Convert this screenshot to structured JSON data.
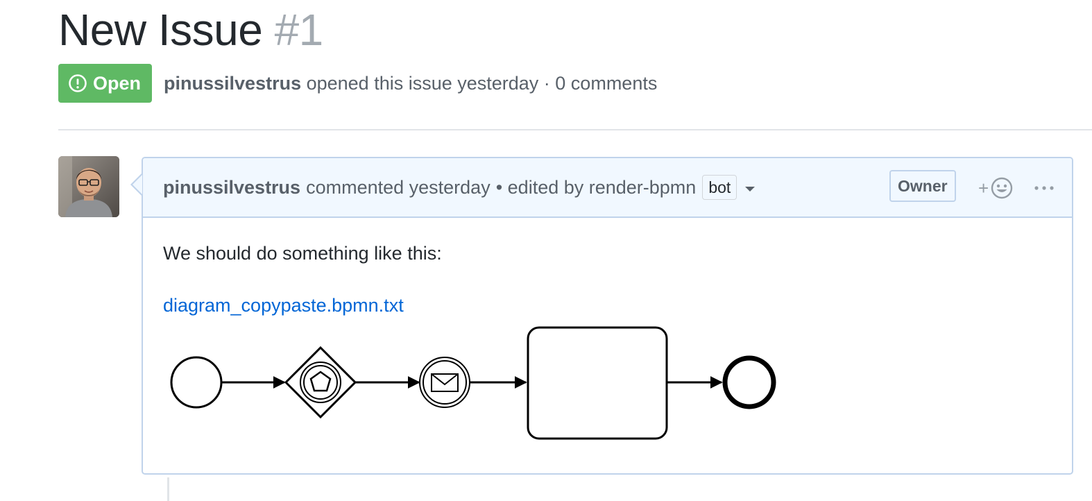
{
  "issue": {
    "title": "New Issue",
    "number": "#1",
    "state": "Open",
    "state_icon": "issue-opened-icon",
    "author": "pinussilvestrus",
    "meta_text": " opened this issue yesterday · 0 comments"
  },
  "comment": {
    "author": "pinussilvestrus",
    "action": "commented yesterday",
    "edited_text": "• edited by render-bpmn",
    "editor_badge": "bot",
    "role_badge": "Owner",
    "reaction_plus": "+",
    "body_text": "We should do something like this:",
    "attachment_name": "diagram_copypaste.bpmn.txt"
  },
  "colors": {
    "open_badge": "#5fb964",
    "link": "#0366d6",
    "comment_header_bg": "#f1f8ff",
    "comment_border": "#c0d3eb"
  },
  "diagram": {
    "type": "bpmn",
    "elements": [
      "start-event",
      "event-based-gateway",
      "message-intermediate-catch-event",
      "task",
      "end-event"
    ]
  }
}
